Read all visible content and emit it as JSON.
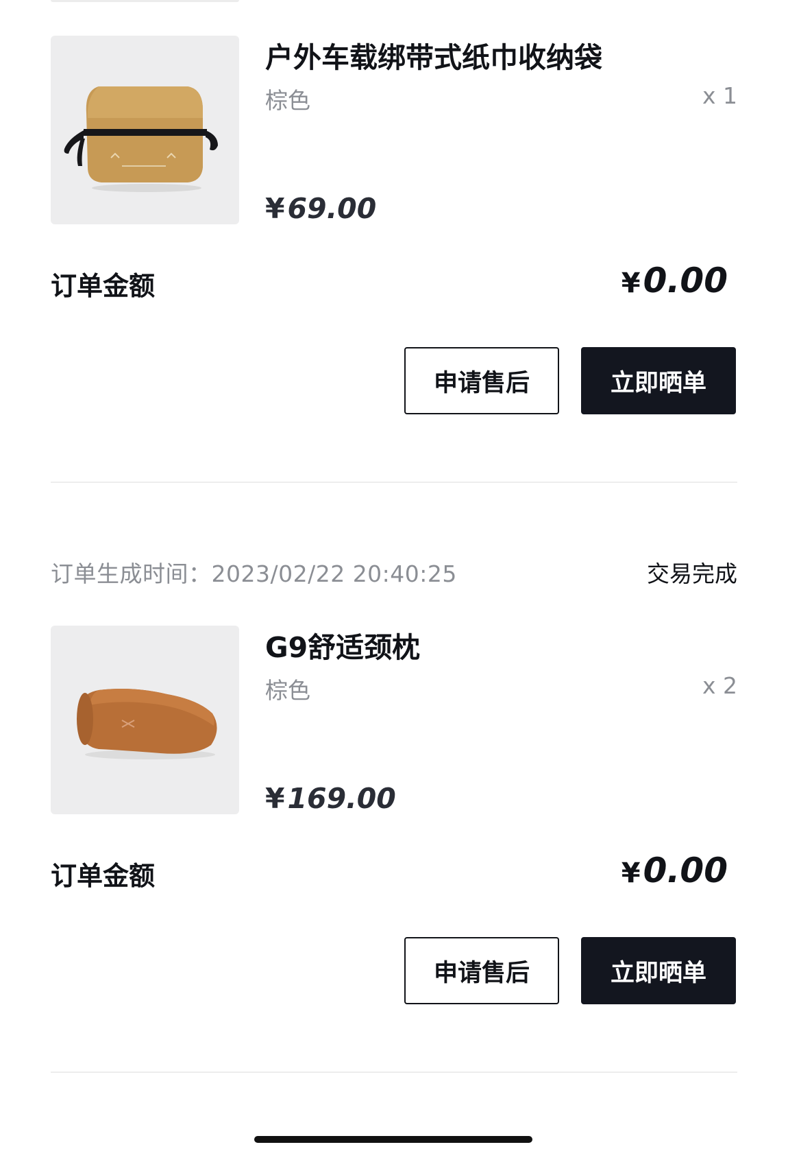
{
  "orders": [
    {
      "time_label": "",
      "status": "",
      "product": {
        "image_icon": "tissue-bag-image",
        "title": "户外车载绑带式纸巾收纳袋",
        "variant": "棕色",
        "qty": "x 1",
        "currency": "¥",
        "price": "69.00"
      },
      "amount_label": "订单金额",
      "amount_currency": "¥",
      "amount": "0.00",
      "buttons": {
        "after_sale": "申请售后",
        "show_order": "立即晒单"
      }
    },
    {
      "time_label": "订单生成时间：2023/02/22 20:40:25",
      "status": "交易完成",
      "product": {
        "image_icon": "neck-pillow-image",
        "title": "G9舒适颈枕",
        "variant": "棕色",
        "qty": "x 2",
        "currency": "¥",
        "price": "169.00"
      },
      "amount_label": "订单金额",
      "amount_currency": "¥",
      "amount": "0.00",
      "buttons": {
        "after_sale": "申请售后",
        "show_order": "立即晒单"
      }
    }
  ],
  "colors": {
    "primary_dark": "#13161f",
    "muted_text": "#8b8e94",
    "thumb_bg": "#ededee",
    "divider": "#ededed"
  }
}
